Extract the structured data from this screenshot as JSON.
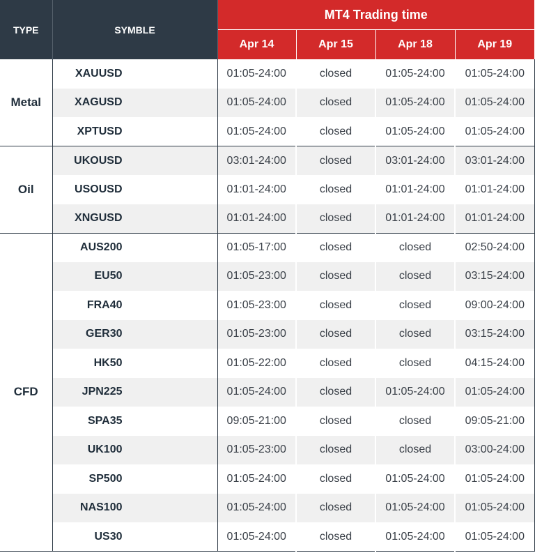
{
  "header": {
    "type_label": "TYPE",
    "symbol_label": "SYMBLE",
    "group_title": "MT4 Trading time",
    "dates": [
      "Apr 14",
      "Apr 15",
      "Apr 18",
      "Apr 19"
    ]
  },
  "groups": [
    {
      "type": "Metal",
      "rows": [
        {
          "symbol": "XAUUSD",
          "times": [
            "01:05-24:00",
            "closed",
            "01:05-24:00",
            "01:05-24:00"
          ]
        },
        {
          "symbol": "XAGUSD",
          "times": [
            "01:05-24:00",
            "closed",
            "01:05-24:00",
            "01:05-24:00"
          ]
        },
        {
          "symbol": "XPTUSD",
          "times": [
            "01:05-24:00",
            "closed",
            "01:05-24:00",
            "01:05-24:00"
          ]
        }
      ]
    },
    {
      "type": "Oil",
      "rows": [
        {
          "symbol": "UKOUSD",
          "times": [
            "03:01-24:00",
            "closed",
            "03:01-24:00",
            "03:01-24:00"
          ]
        },
        {
          "symbol": "USOUSD",
          "times": [
            "01:01-24:00",
            "closed",
            "01:01-24:00",
            "01:01-24:00"
          ]
        },
        {
          "symbol": "XNGUSD",
          "times": [
            "01:01-24:00",
            "closed",
            "01:01-24:00",
            "01:01-24:00"
          ]
        }
      ]
    },
    {
      "type": "CFD",
      "rows": [
        {
          "symbol": "AUS200",
          "times": [
            "01:05-17:00",
            "closed",
            "closed",
            "02:50-24:00"
          ]
        },
        {
          "symbol": "EU50",
          "times": [
            "01:05-23:00",
            "closed",
            "closed",
            "03:15-24:00"
          ]
        },
        {
          "symbol": "FRA40",
          "times": [
            "01:05-23:00",
            "closed",
            "closed",
            "09:00-24:00"
          ]
        },
        {
          "symbol": "GER30",
          "times": [
            "01:05-23:00",
            "closed",
            "closed",
            "03:15-24:00"
          ]
        },
        {
          "symbol": "HK50",
          "times": [
            "01:05-22:00",
            "closed",
            "closed",
            "04:15-24:00"
          ]
        },
        {
          "symbol": "JPN225",
          "times": [
            "01:05-24:00",
            "closed",
            "01:05-24:00",
            "01:05-24:00"
          ]
        },
        {
          "symbol": "SPA35",
          "times": [
            "09:05-21:00",
            "closed",
            "closed",
            "09:05-21:00"
          ]
        },
        {
          "symbol": "UK100",
          "times": [
            "01:05-23:00",
            "closed",
            "closed",
            "03:00-24:00"
          ]
        },
        {
          "symbol": "SP500",
          "times": [
            "01:05-24:00",
            "closed",
            "01:05-24:00",
            "01:05-24:00"
          ]
        },
        {
          "symbol": "NAS100",
          "times": [
            "01:05-24:00",
            "closed",
            "01:05-24:00",
            "01:05-24:00"
          ]
        },
        {
          "symbol": "US30",
          "times": [
            "01:05-24:00",
            "closed",
            "01:05-24:00",
            "01:05-24:00"
          ]
        }
      ]
    }
  ],
  "colors": {
    "header_dark": "#2e3a46",
    "header_red": "#d32a2a",
    "row_shade": "#f0f0f0"
  }
}
